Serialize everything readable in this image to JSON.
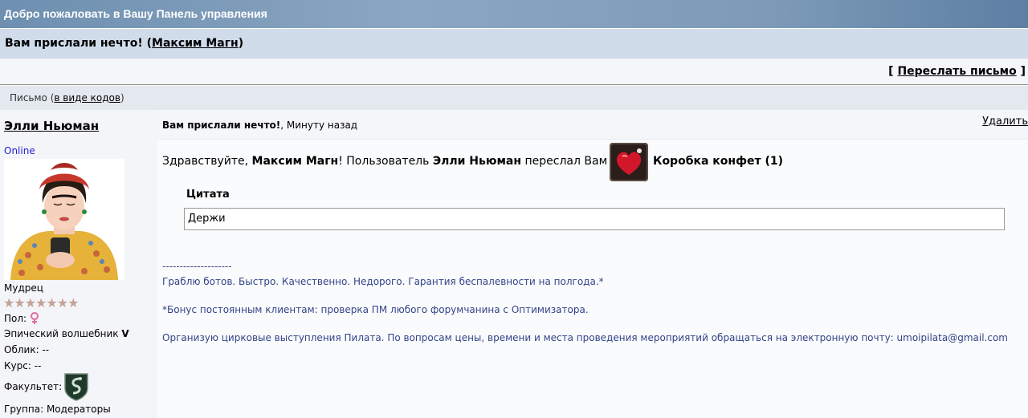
{
  "header": {
    "title": "Добро пожаловать в Вашу Панель управления"
  },
  "subject": {
    "text": "Вам прислали нечто! (",
    "sender_link": "Максим Магн",
    "close": ")"
  },
  "actions": {
    "bracket_open": "[ ",
    "forward": "Переслать письмо",
    "bracket_close": " ]"
  },
  "view": {
    "label": "Письмо (",
    "codes_link": "в виде кодов",
    "close": ")"
  },
  "author": {
    "name": "Элли Ньюман",
    "status": "Online",
    "rank": "Мудрец",
    "gender_label": "Пол:",
    "title_prefix": "Эпический волшебник ",
    "title_suffix": "V",
    "appearance": "Облик: --",
    "course": "Курс: --",
    "faculty_label": "Факультет:",
    "group": "Группа: Модераторы"
  },
  "message": {
    "title_bold": "Вам прислали нечто!",
    "time": ", Минуту назад",
    "delete": "Удалить",
    "greet_1": "Здравствуйте, ",
    "recipient": "Максим Магн",
    "greet_2": "! Пользователь ",
    "from_user": "Элли Ньюман",
    "greet_3": " переслал Вам",
    "gift": "Коробка конфет (1)",
    "quote_label": "Цитата",
    "quote_text": "Держи"
  },
  "signature": {
    "separator": "--------------------",
    "line1": "Граблю ботов. Быстро. Качественно. Недорого. Гарантия беспалевности на полгода.*",
    "line2": "*Бонус постоянным клиентам: проверка ПМ любого форумчанина с Оптимизатора.",
    "line3": "Организую цирковые выступления Пилата. По вопросам цены, времени и места проведения мероприятий обращаться на электронную почту: umoipilata@gmail.com"
  },
  "colors": {
    "header_bg": "#7d9ab8",
    "subject_bg": "#d1dceb",
    "online": "#2222cc",
    "signature": "#334488"
  },
  "icons": {
    "gender": "female-symbol-icon",
    "faculty": "snake-crest-icon",
    "gift": "heart-candy-box-icon"
  }
}
